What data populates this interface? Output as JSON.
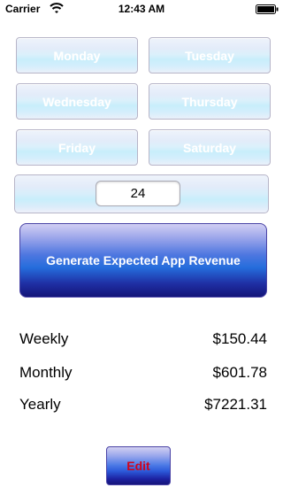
{
  "status_bar": {
    "carrier": "Carrier",
    "time": "12:43 AM",
    "wifi_icon": "wifi-icon",
    "battery_icon": "battery-icon"
  },
  "days": {
    "monday": "Monday",
    "tuesday": "Tuesday",
    "wednesday": "Wednesday",
    "thursday": "Thursday",
    "friday": "Friday",
    "saturday": "Saturday"
  },
  "hours_field": {
    "value": "24"
  },
  "generate_button": {
    "label": "Generate Expected App Revenue"
  },
  "results": {
    "weekly_label": "Weekly",
    "weekly_value": "$150.44",
    "monthly_label": "Monthly",
    "monthly_value": "$601.78",
    "yearly_label": "Yearly",
    "yearly_value": "$7221.31"
  },
  "edit_button": {
    "label": "Edit"
  },
  "colors": {
    "edit_label": "#d0051c",
    "generate_button_dark": "#131579",
    "generate_button_mid": "#256ddc"
  }
}
